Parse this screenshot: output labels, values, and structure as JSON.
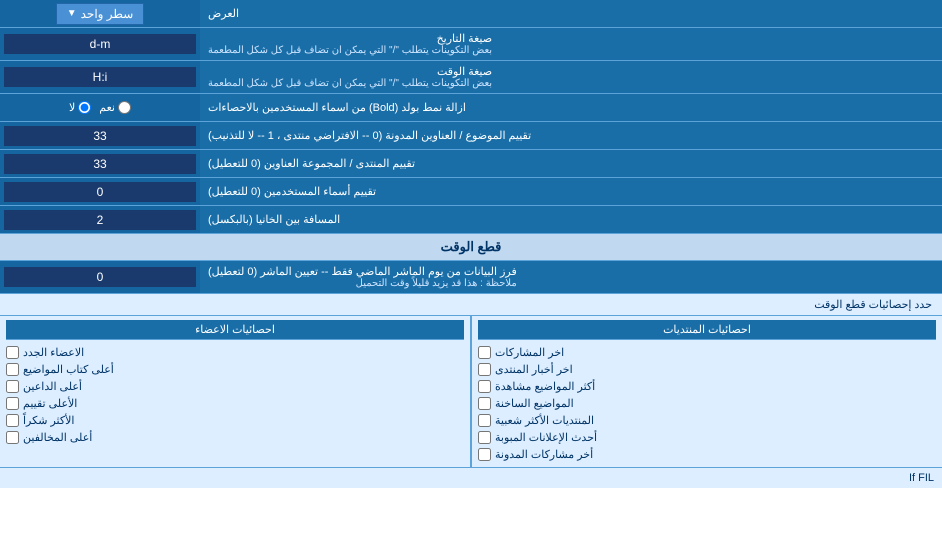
{
  "header": {
    "label": "العرض",
    "dropdown_label": "سطر واحد"
  },
  "rows": [
    {
      "id": "date-format",
      "label": "صيغة التاريخ",
      "sublabel": "بعض التكوينات يتطلب \"/\" التي يمكن ان تضاف قبل كل شكل المطعمة",
      "value": "d-m",
      "type": "input"
    },
    {
      "id": "time-format",
      "label": "صيغة الوقت",
      "sublabel": "بعض التكوينات يتطلب \"/\" التي يمكن ان تضاف قبل كل شكل المطعمة",
      "value": "H:i",
      "type": "input"
    },
    {
      "id": "remove-bold",
      "label": "ازالة نمط بولد (Bold) من اسماء المستخدمين بالاحصاءات",
      "type": "radio",
      "options": [
        "نعم",
        "لا"
      ],
      "selected": "لا"
    },
    {
      "id": "topic-subject",
      "label": "تقييم الموضوع / العناوين المدونة (0 -- الافتراضي منتدى ، 1 -- لا للتذنيب)",
      "value": "33",
      "type": "input"
    },
    {
      "id": "forum-topic",
      "label": "تقييم المنتدى / المجموعة العناوين (0 للتعطيل)",
      "value": "33",
      "type": "input"
    },
    {
      "id": "usernames",
      "label": "تقييم أسماء المستخدمين (0 للتعطيل)",
      "value": "0",
      "type": "input"
    },
    {
      "id": "distance",
      "label": "المسافة بين الخانيا (بالبكسل)",
      "value": "2",
      "type": "input"
    }
  ],
  "cutoff_section": {
    "title": "قطع الوقت",
    "row": {
      "label": "فرز البيانات من يوم الماشر الماضي فقط -- تعيين الماشر (0 لتعطيل)",
      "sublabel": "ملاحظة : هذا قد يزيد قليلاً وقت التحميل",
      "value": "0"
    },
    "limit_text": "حدد إحصائيات قطع الوقت"
  },
  "checkboxes": {
    "col1_header": "احصائيات المنتديات",
    "col1_items": [
      "اخر المشاركات",
      "اخر أخبار المنتدى",
      "أكثر المواضيع مشاهدة",
      "المواضيع الساخنة",
      "المنتديات الأكثر شعبية",
      "أحدث الإعلانات المبوبة",
      "أخر مشاركات المدونة"
    ],
    "col2_header": "احصائيات الاعضاء",
    "col2_items": [
      "الاعضاء الجدد",
      "أعلى كتاب المواضيع",
      "أعلى الداعين",
      "الأعلى تقييم",
      "الأكثر شكراً",
      "أعلى المخالفين"
    ]
  },
  "bottom_text": "If FIL"
}
